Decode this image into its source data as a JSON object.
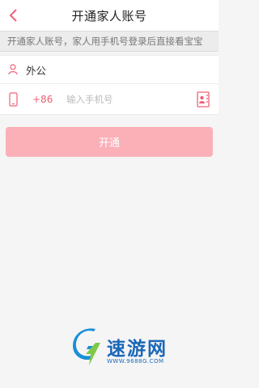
{
  "header": {
    "title": "开通家人账号",
    "back_icon": "chevron-left-icon"
  },
  "notice": {
    "text": "开通家人账号，家人用手机号登录后直接看宝宝"
  },
  "form": {
    "name": {
      "icon": "person-icon",
      "value": "外公"
    },
    "phone": {
      "icon": "mobile-phone-icon",
      "country_code": "+86",
      "placeholder": "输入手机号",
      "contact_icon": "contact-book-icon"
    }
  },
  "submit": {
    "label": "开通"
  },
  "watermark": {
    "text": "速游网",
    "url": "WWW.9688G.COM"
  },
  "colors": {
    "accent": "#f06075",
    "button": "#fbb0b8",
    "background": "#f5f5f5",
    "watermark": "#1a67b8"
  }
}
